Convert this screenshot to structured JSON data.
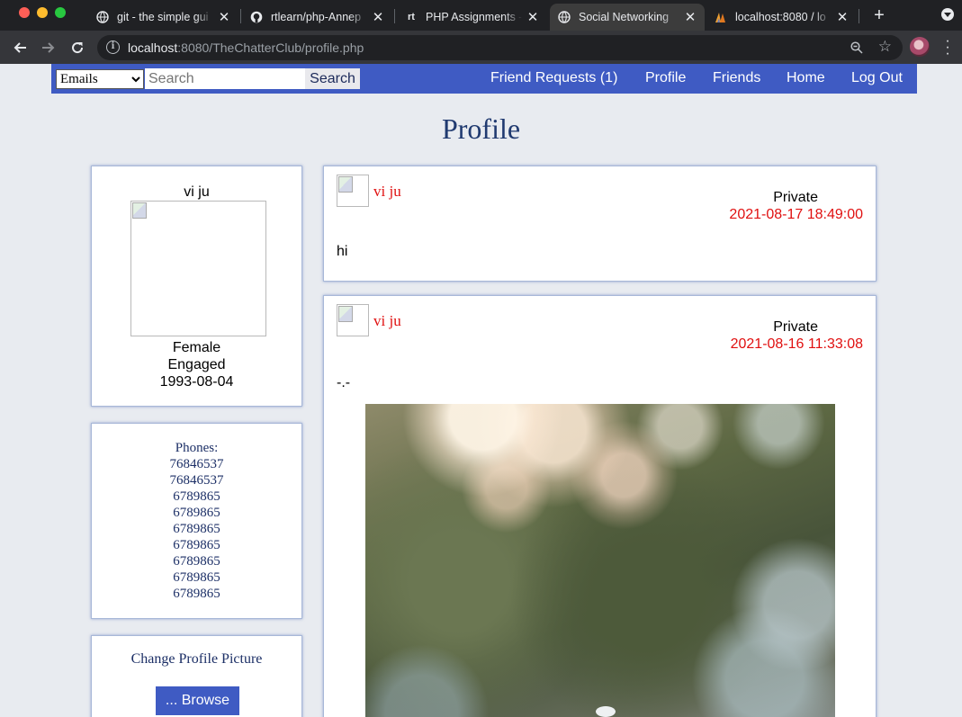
{
  "browser": {
    "tabs": [
      {
        "title": "git - the simple gui",
        "icon": "globe-icon"
      },
      {
        "title": "rtlearn/php-Annep",
        "icon": "github-icon"
      },
      {
        "title": "PHP Assignments -",
        "icon": "rt-icon",
        "icon_text": "rt"
      },
      {
        "title": "Social Networking",
        "icon": "globe-icon",
        "active": true
      },
      {
        "title": "localhost:8080 / lo",
        "icon": "phpmyadmin-icon"
      }
    ],
    "url_host": "localhost",
    "url_rest": ":8080/TheChatterClub/profile.php"
  },
  "nav": {
    "select_value": "Emails",
    "search_placeholder": "Search",
    "search_button": "Search",
    "links": [
      "Friend Requests (1)",
      "Profile",
      "Friends",
      "Home",
      "Log Out"
    ]
  },
  "page": {
    "title": "Profile"
  },
  "profile": {
    "name": "vi ju",
    "gender": "Female",
    "relationship": "Engaged",
    "dob": "1993-08-04"
  },
  "phones": {
    "label": "Phones:",
    "numbers": [
      "76846537",
      "76846537",
      "6789865",
      "6789865",
      "6789865",
      "6789865",
      "6789865",
      "6789865",
      "6789865"
    ]
  },
  "picture": {
    "label": "Change Profile Picture",
    "browse_button": "... Browse"
  },
  "posts": [
    {
      "author": "vi ju",
      "privacy": "Private",
      "date": "2021-08-17 18:49:00",
      "text": "hi"
    },
    {
      "author": "vi ju",
      "privacy": "Private",
      "date": "2021-08-16 11:33:08",
      "text": "-.-"
    }
  ],
  "colors": {
    "nav_bg": "#3f5bc3",
    "accent_red": "#e01010",
    "title_blue": "#203a70"
  }
}
